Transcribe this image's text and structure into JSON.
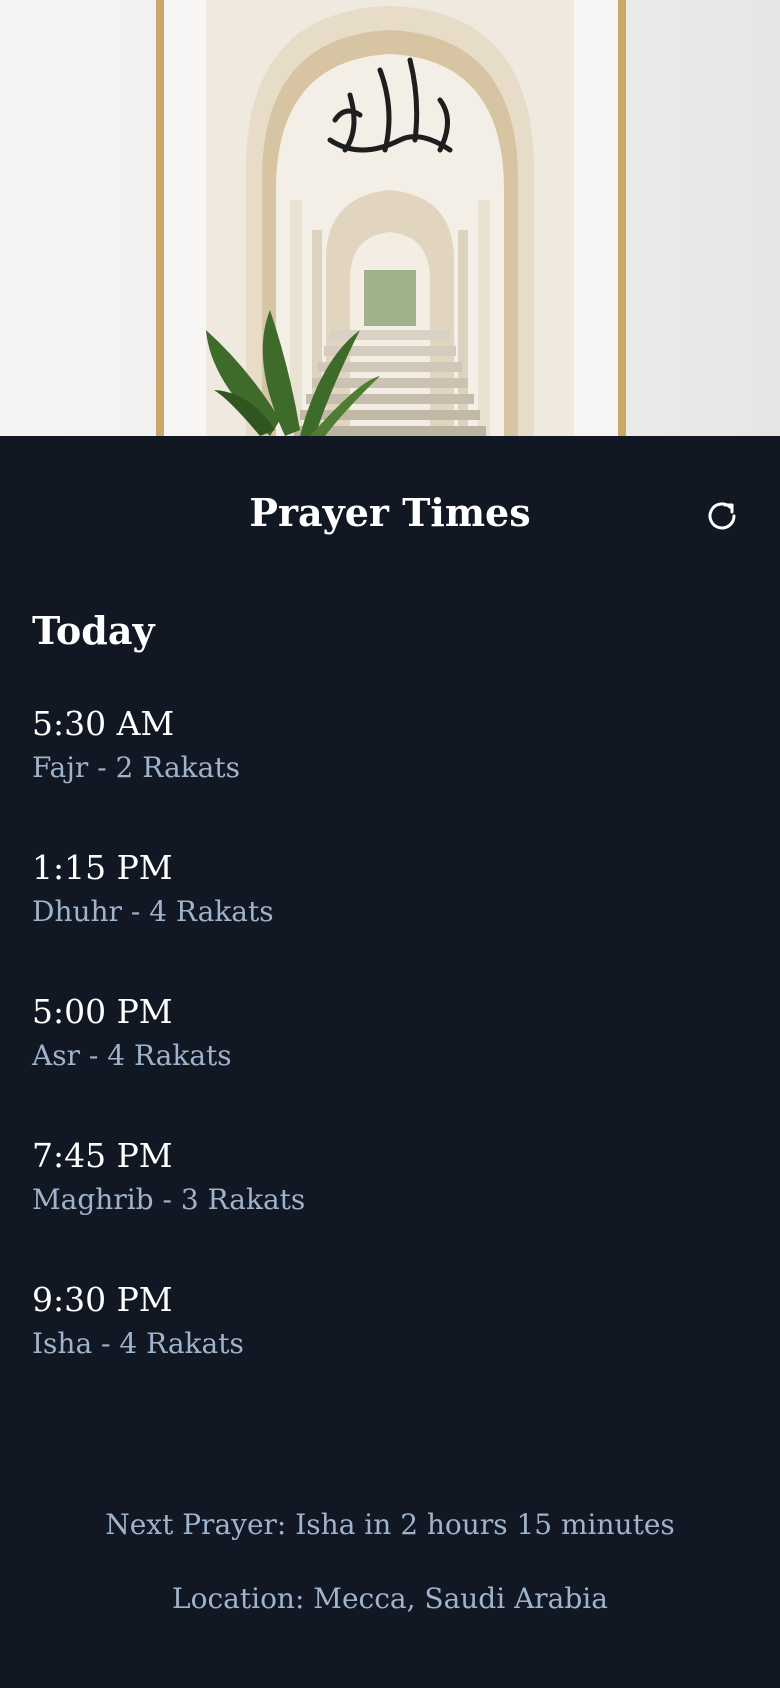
{
  "header": {
    "title": "Prayer Times",
    "refresh_icon": "refresh-icon"
  },
  "hero": {
    "calligraphy_icon": "arabic-calligraphy-art"
  },
  "today": {
    "label": "Today",
    "prayers": [
      {
        "time": "5:30 AM",
        "name": "Fajr - 2 Rakats"
      },
      {
        "time": "1:15 PM",
        "name": "Dhuhr - 4 Rakats"
      },
      {
        "time": "5:00 PM",
        "name": "Asr - 4 Rakats"
      },
      {
        "time": "7:45 PM",
        "name": "Maghrib - 3 Rakats"
      },
      {
        "time": "9:30 PM",
        "name": "Isha - 4 Rakats"
      }
    ]
  },
  "footer": {
    "next_prayer": "Next Prayer: Isha in 2 hours 15 minutes",
    "location": "Location: Mecca, Saudi Arabia"
  },
  "colors": {
    "background": "#111823",
    "text_primary": "#ffffff",
    "text_secondary": "#9fb3cc"
  }
}
